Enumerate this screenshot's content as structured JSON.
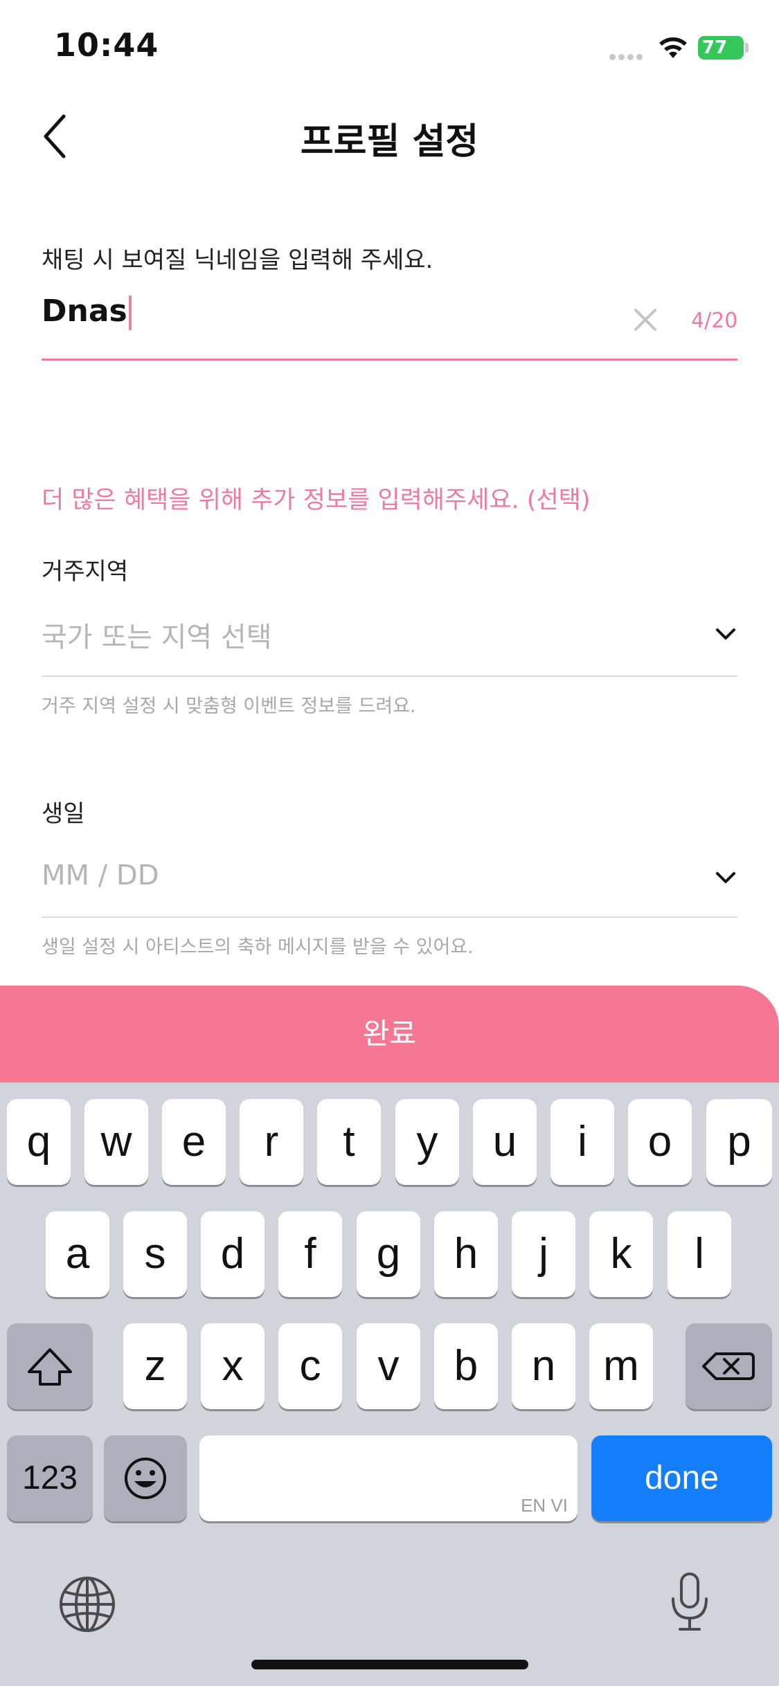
{
  "status_bar": {
    "time": "10:44",
    "battery": "77"
  },
  "nav": {
    "title": "프로필 설정"
  },
  "nickname": {
    "prompt": "채팅 시 보여질 닉네임을 입력해 주세요.",
    "value": "Dnas",
    "counter": "4/20"
  },
  "optional_info": {
    "heading": "더 많은 혜택을 위해 추가 정보를 입력해주세요. (선택)"
  },
  "region": {
    "label": "거주지역",
    "placeholder": "국가 또는 지역 선택",
    "helper": "거주 지역 설정 시 맞춤형 이벤트 정보를 드려요."
  },
  "birthday": {
    "label": "생일",
    "placeholder": "MM / DD",
    "helper": "생일 설정 시 아티스트의 축하 메시지를 받을 수 있어요."
  },
  "complete_button": {
    "label": "완료"
  },
  "keyboard": {
    "row1": [
      "q",
      "w",
      "e",
      "r",
      "t",
      "y",
      "u",
      "i",
      "o",
      "p"
    ],
    "row2": [
      "a",
      "s",
      "d",
      "f",
      "g",
      "h",
      "j",
      "k",
      "l"
    ],
    "row3": [
      "z",
      "x",
      "c",
      "v",
      "b",
      "n",
      "m"
    ],
    "numbers_label": "123",
    "done_label": "done",
    "space_lang": "EN VI"
  },
  "colors": {
    "accent": "#ef7b9c",
    "button": "#f57794",
    "done_key": "#157efb"
  }
}
